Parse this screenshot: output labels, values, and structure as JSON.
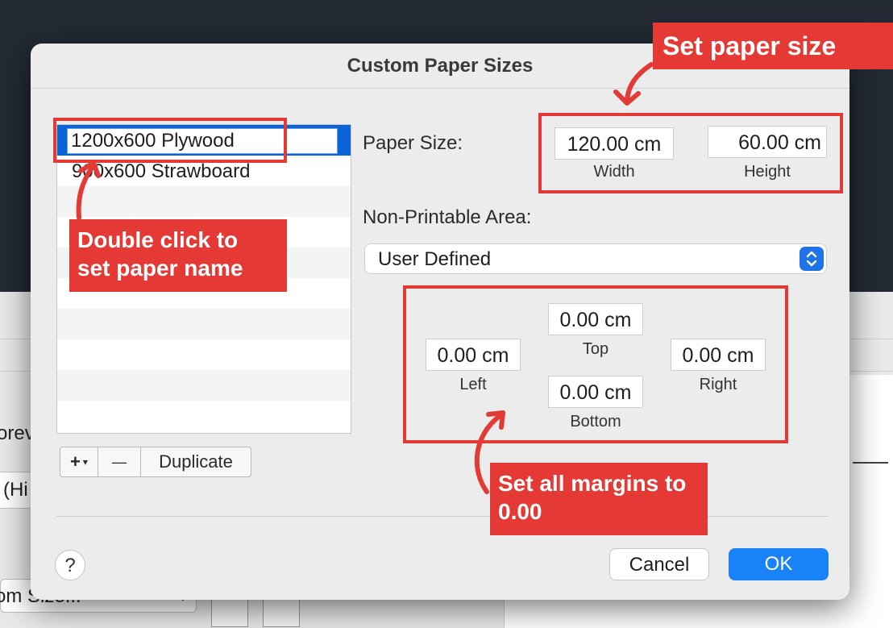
{
  "background": {
    "left_texts": [
      "orev",
      "(Hi",
      "om Size..."
    ]
  },
  "dialog": {
    "title": "Custom Paper Sizes",
    "list": {
      "items": [
        "1200x600 Plywood",
        "900x600 Strawboard"
      ],
      "editing_value": "1200x600 Plywood"
    },
    "list_buttons": {
      "add": "+",
      "add_arrow": "▾",
      "remove": "—",
      "duplicate": "Duplicate"
    },
    "paper_size": {
      "label": "Paper Size:",
      "width_value": "120.00 cm",
      "width_label": "Width",
      "height_value": "60.00 cm",
      "height_label": "Height"
    },
    "non_printable": {
      "label": "Non-Printable Area:",
      "selected": "User Defined"
    },
    "margins": {
      "top_value": "0.00 cm",
      "top_label": "Top",
      "left_value": "0.00 cm",
      "left_label": "Left",
      "right_value": "0.00 cm",
      "right_label": "Right",
      "bottom_value": "0.00 cm",
      "bottom_label": "Bottom"
    },
    "help": "?",
    "cancel": "Cancel",
    "ok": "OK"
  },
  "annotations": {
    "paper_size_callout": "Set paper size",
    "name_callout_line1": "Double click to",
    "name_callout_line2": "set paper name",
    "margins_callout_line1": "Set all margins to",
    "margins_callout_line2": "0.00"
  },
  "colors": {
    "annotation_red": "#e53935",
    "selection_blue": "#0a64d8",
    "ok_blue": "#1a82f7"
  }
}
